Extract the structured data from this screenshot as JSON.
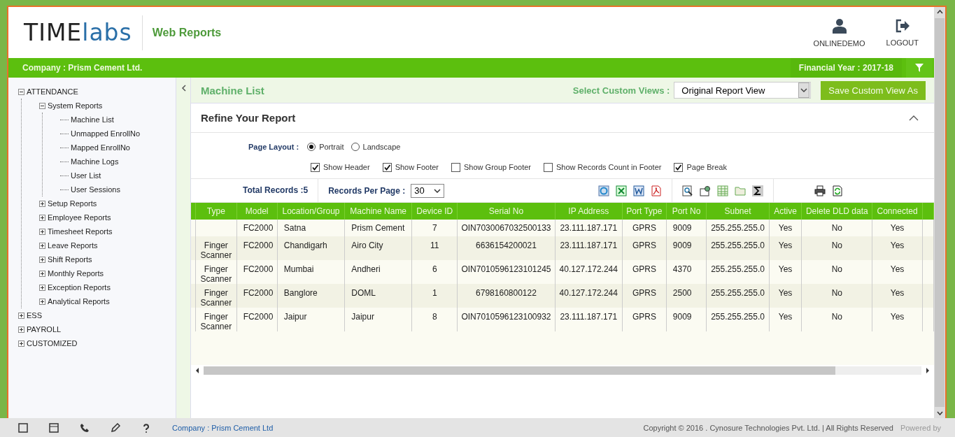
{
  "header": {
    "logo": {
      "dark": "TIME",
      "light": "labs"
    },
    "app_title": "Web Reports",
    "user": "ONLINEDEMO",
    "logout": "LOGOUT"
  },
  "company_bar": {
    "company": "Company : Prism Cement Ltd.",
    "financial_year": "Financial Year : 2017-18"
  },
  "sidebar": {
    "items": [
      {
        "label": "ATTENDANCE",
        "expanded": true,
        "children": [
          {
            "label": "System Reports",
            "expanded": true,
            "children": [
              {
                "label": "Machine List"
              },
              {
                "label": "Unmapped EnrollNo"
              },
              {
                "label": "Mapped EnrollNo"
              },
              {
                "label": "Machine Logs"
              },
              {
                "label": "User List"
              },
              {
                "label": "User Sessions"
              }
            ]
          },
          {
            "label": "Setup Reports",
            "expanded": false
          },
          {
            "label": "Employee Reports",
            "expanded": false
          },
          {
            "label": "Timesheet Reports",
            "expanded": false
          },
          {
            "label": "Leave Reports",
            "expanded": false
          },
          {
            "label": "Shift Reports",
            "expanded": false
          },
          {
            "label": "Monthly Reports",
            "expanded": false
          },
          {
            "label": "Exception Reports",
            "expanded": false
          },
          {
            "label": "Analytical Reports",
            "expanded": false
          }
        ]
      },
      {
        "label": "ESS",
        "expanded": false
      },
      {
        "label": "PAYROLL",
        "expanded": false
      },
      {
        "label": "CUSTOMIZED",
        "expanded": false
      }
    ]
  },
  "report": {
    "title": "Machine List",
    "custom_views_label": "Select Custom Views :",
    "custom_view": "Original Report View",
    "save_button": "Save Custom View As"
  },
  "refine": {
    "title": "Refine Your Report",
    "expanded": true,
    "page_layout_label": "Page Layout :",
    "layouts": [
      {
        "label": "Portrait",
        "selected": true
      },
      {
        "label": "Landscape",
        "selected": false
      }
    ],
    "options": [
      {
        "label": "Show Header",
        "checked": true
      },
      {
        "label": "Show Footer",
        "checked": true
      },
      {
        "label": "Show Group Footer",
        "checked": false
      },
      {
        "label": "Show Records Count in Footer",
        "checked": false
      },
      {
        "label": "Page Break",
        "checked": true
      }
    ]
  },
  "records": {
    "total": "Total Records :5",
    "per_page_label": "Records Per Page :",
    "per_page": "30"
  },
  "table": {
    "columns": [
      "Type",
      "Model",
      "Location/Group",
      "Machine Name",
      "Device ID",
      "Serial No",
      "IP Address",
      "Port Type",
      "Port No",
      "Subnet",
      "Active",
      "Delete DLD data",
      "Connected"
    ],
    "rows": [
      [
        "",
        "FC2000",
        "Satna",
        "Prism Cement",
        "7",
        "OIN7030067032500133",
        "23.111.187.171",
        "GPRS",
        "9009",
        "255.255.255.0",
        "Yes",
        "No",
        "Yes"
      ],
      [
        "Finger Scanner",
        "FC2000",
        "Chandigarh",
        "Airo City",
        "11",
        "6636154200021",
        "23.111.187.171",
        "GPRS",
        "9009",
        "255.255.255.0",
        "Yes",
        "No",
        "Yes"
      ],
      [
        "Finger Scanner",
        "FC2000",
        "Mumbai",
        "Andheri",
        "6",
        "OIN7010596123101245",
        "40.127.172.244",
        "GPRS",
        "4370",
        "255.255.255.0",
        "Yes",
        "No",
        "Yes"
      ],
      [
        "Finger Scanner",
        "FC2000",
        "Banglore",
        "DOML",
        "1",
        "6798160800122",
        "40.127.172.244",
        "GPRS",
        "2500",
        "255.255.255.0",
        "Yes",
        "No",
        "Yes"
      ],
      [
        "Finger Scanner",
        "FC2000",
        "Jaipur",
        "Jaipur",
        "8",
        "OIN7010596123100932",
        "23.111.187.171",
        "GPRS",
        "9009",
        "255.255.255.0",
        "Yes",
        "No",
        "Yes"
      ]
    ]
  },
  "footer": {
    "company": "Company : Prism Cement Ltd",
    "copyright": "Copyright © 2016 . Cynosure Technologies Pvt. Ltd. | All Rights Reserved",
    "powered_by": "Powered by"
  }
}
